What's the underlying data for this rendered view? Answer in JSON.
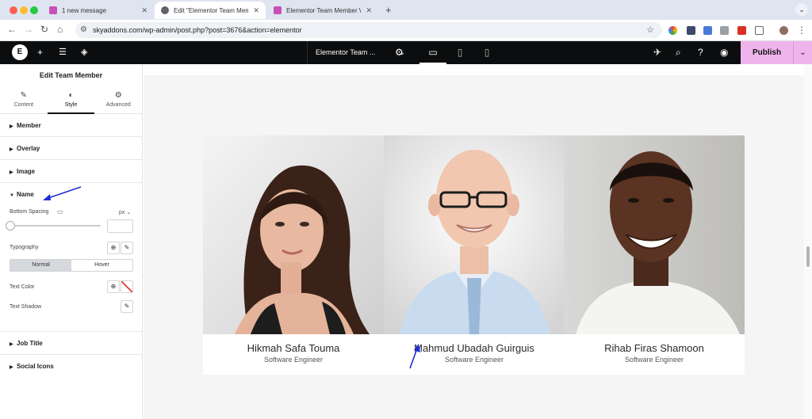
{
  "browser": {
    "tabs": [
      {
        "title": "1 new message",
        "favicon_color": "#c94fb8"
      },
      {
        "title": "Edit \"Elementor Team Member",
        "favicon_color": "#5f6368"
      },
      {
        "title": "Elementor Team Member Wid",
        "favicon_color": "#c94fb8"
      }
    ],
    "url": "skyaddons.com/wp-admin/post.php?post=3676&action=elementor",
    "traffic_colors": [
      "#fe5f57",
      "#febc2e",
      "#28c840"
    ]
  },
  "editor_bar": {
    "document_title": "Elementor Team ...",
    "publish_label": "Publish",
    "accent_color": "#f0b4ec"
  },
  "panel": {
    "title": "Edit Team Member",
    "tabs": [
      {
        "label": "Content",
        "icon": "pencil-icon"
      },
      {
        "label": "Style",
        "icon": "half-circle-icon"
      },
      {
        "label": "Advanced",
        "icon": "gear-icon"
      }
    ],
    "sections_top": [
      "Member",
      "Overlay",
      "Image"
    ],
    "name_section": {
      "title": "Name",
      "bottom_spacing_label": "Bottom Spacing",
      "unit": "px",
      "typography_label": "Typography",
      "state_normal": "Normal",
      "state_hover": "Hover",
      "text_color_label": "Text Color",
      "text_shadow_label": "Text Shadow"
    },
    "sections_bottom": [
      "Job Title",
      "Social Icons"
    ]
  },
  "members": [
    {
      "name": "Hikmah Safa Touma",
      "job": "Software Engineer"
    },
    {
      "name": "Mahmud Ubadah Guirguis",
      "job": "Software Engineer"
    },
    {
      "name": "Rihab Firas Shamoon",
      "job": "Software Engineer"
    }
  ]
}
